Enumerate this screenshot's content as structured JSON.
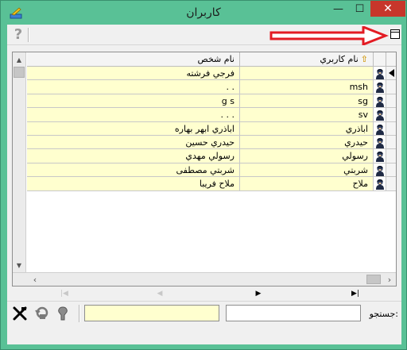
{
  "window": {
    "title": "كاربران",
    "min_glyph": "—",
    "max_glyph": "☐",
    "close_glyph": "✕"
  },
  "toolbar": {
    "help_glyph": "?"
  },
  "grid": {
    "columns": {
      "fullname": "نام شخص",
      "username": "نام كاربري"
    },
    "rows": [
      {
        "username": "",
        "fullname": "فرجي فرشته"
      },
      {
        "username": "msh",
        "fullname": ". ."
      },
      {
        "username": "sg",
        "fullname": "g s"
      },
      {
        "username": "sv",
        "fullname": ". . ."
      },
      {
        "username": "اباذري",
        "fullname": "اباذري ابهر بهاره"
      },
      {
        "username": "حيدري",
        "fullname": "حيدري حسين"
      },
      {
        "username": "رسولي",
        "fullname": "رسولي مهدي"
      },
      {
        "username": "شربتي",
        "fullname": "شربتي مصطفى"
      },
      {
        "username": "ملاح",
        "fullname": "ملاح فريبا"
      }
    ],
    "selected_row": 0
  },
  "search": {
    "label": "جستجو:",
    "value": "",
    "filter_value": ""
  },
  "colors": {
    "frame": "#59c196",
    "close": "#c7362b",
    "cell_fill": "#ffffcf"
  }
}
